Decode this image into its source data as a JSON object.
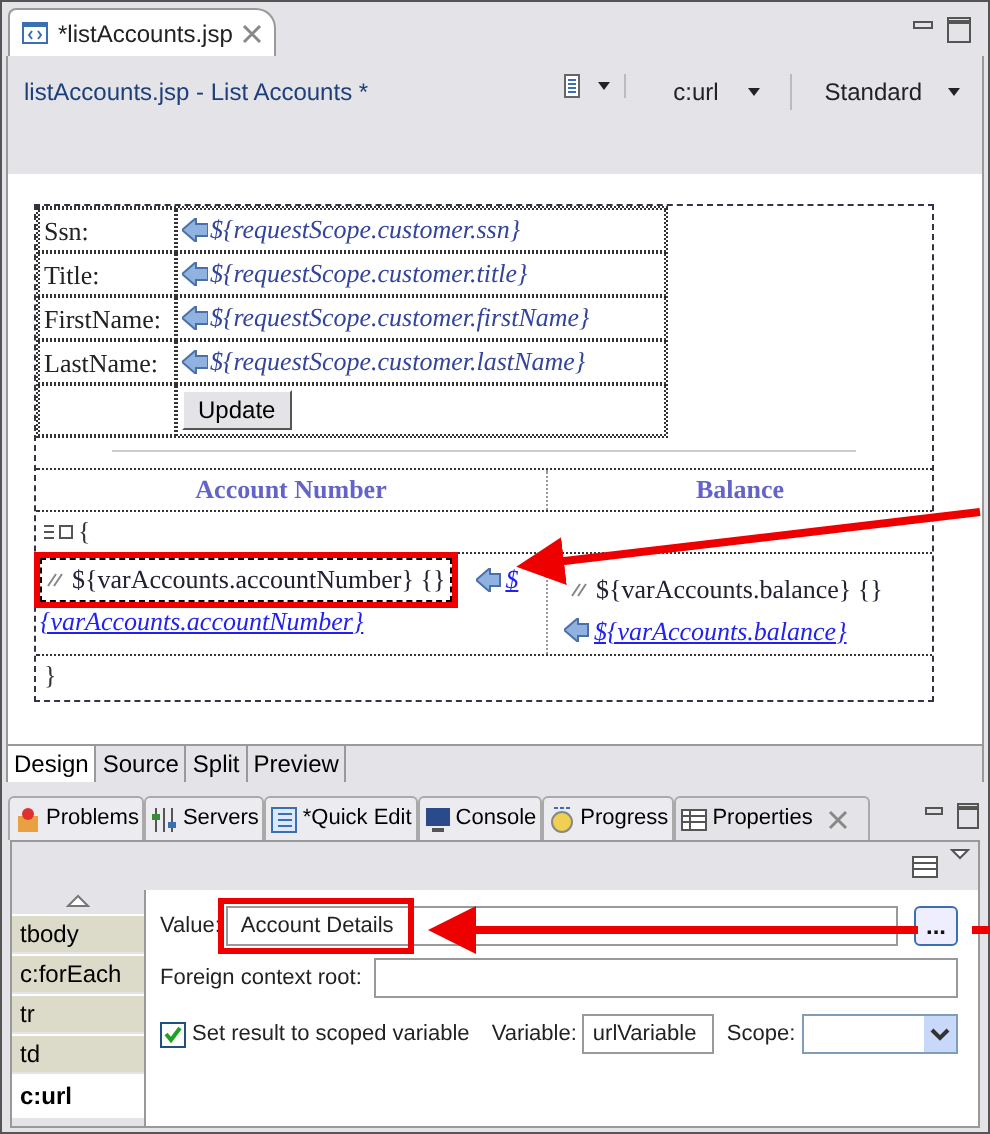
{
  "editor_tab": {
    "title": "*listAccounts.jsp",
    "selected": true
  },
  "editor_header": {
    "title": "listAccounts.jsp - List Accounts *",
    "tag_selector": "c:url",
    "palette": "Standard"
  },
  "form_rows": [
    {
      "label": "Ssn:",
      "expression": "${requestScope.customer.ssn}"
    },
    {
      "label": "Title:",
      "expression": "${requestScope.customer.title}"
    },
    {
      "label": "FirstName:",
      "expression": "${requestScope.customer.firstName}"
    },
    {
      "label": "LastName:",
      "expression": "${requestScope.customer.lastName}"
    }
  ],
  "update_button": "Update",
  "table": {
    "columns": [
      "Account Number",
      "Balance"
    ],
    "loop_open": "{",
    "loop_close": "}",
    "cells": [
      {
        "output": "${varAccounts.accountNumber} {}",
        "link_parts": [
          "$",
          "{varAccounts.accountNumber}"
        ],
        "highlighted": true
      },
      {
        "output": "${varAccounts.balance} {}",
        "link_parts": [
          "${varAccounts.balance}"
        ],
        "highlighted": false
      }
    ]
  },
  "design_tabs": [
    {
      "label": "Design",
      "selected": true
    },
    {
      "label": "Source",
      "selected": false
    },
    {
      "label": "Split",
      "selected": false
    },
    {
      "label": "Preview",
      "selected": false
    }
  ],
  "view_tabs": [
    {
      "label": "Problems",
      "kind": "problems",
      "selected": false
    },
    {
      "label": "Servers",
      "kind": "servers",
      "selected": false
    },
    {
      "label": "*Quick Edit",
      "kind": "quickedit",
      "selected": false
    },
    {
      "label": "Console",
      "kind": "console",
      "selected": false
    },
    {
      "label": "Progress",
      "kind": "progress",
      "selected": false
    },
    {
      "label": "Properties",
      "kind": "properties",
      "selected": true
    }
  ],
  "property_sections": [
    {
      "label": "tbody",
      "selected": false
    },
    {
      "label": "c:forEach",
      "selected": false
    },
    {
      "label": "tr",
      "selected": false
    },
    {
      "label": "td",
      "selected": false
    },
    {
      "label": "c:url",
      "selected": true
    }
  ],
  "properties": {
    "value_label": "Value:",
    "value": "Account Details",
    "value_highlighted": true,
    "browse_button": "...",
    "foreign_root_label": "Foreign context root:",
    "scoped_checkbox": {
      "label": "Set result to scoped variable",
      "checked": true
    },
    "variable_label": "Variable:",
    "variable": "urlVariable",
    "scope_label": "Scope:"
  }
}
